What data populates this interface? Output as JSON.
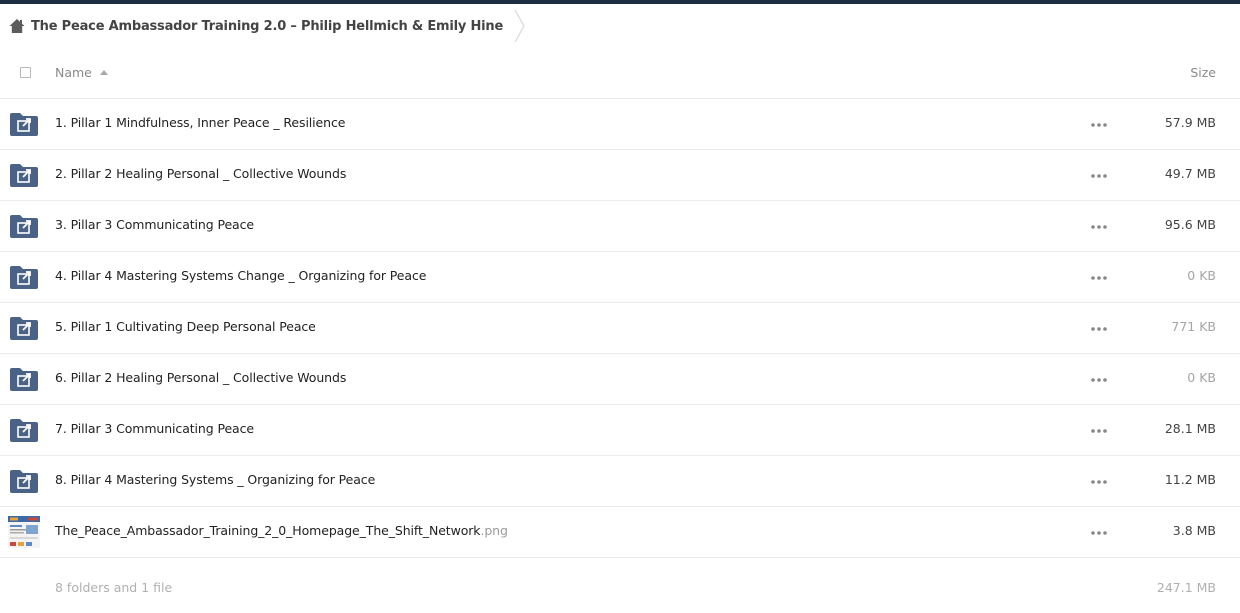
{
  "breadcrumb": {
    "home_icon": "home-icon",
    "folder_name": "The Peace Ambassador Training 2.0 – Philip Hellmich & Emily Hine"
  },
  "header": {
    "name_label": "Name",
    "size_label": "Size",
    "sort_icon": "sort-ascending-icon"
  },
  "colors": {
    "folder": "#4a6286",
    "topbar": "#1d2d44",
    "size_dark": "#444444",
    "size_light": "#a5a5a5"
  },
  "rows": [
    {
      "name": "1. Pillar 1 Mindfulness, Inner Peace _ Resilience",
      "ext": "",
      "size": "57.9 MB",
      "icon": "shared-folder-icon"
    },
    {
      "name": "2. Pillar 2 Healing Personal _ Collective Wounds",
      "ext": "",
      "size": "49.7 MB",
      "icon": "shared-folder-icon"
    },
    {
      "name": "3. Pillar 3 Communicating Peace",
      "ext": "",
      "size": "95.6 MB",
      "icon": "shared-folder-icon"
    },
    {
      "name": "4. Pillar 4 Mastering Systems Change _ Organizing for Peace",
      "ext": "",
      "size": "0 KB",
      "icon": "shared-folder-icon"
    },
    {
      "name": "5. Pillar 1 Cultivating Deep Personal Peace",
      "ext": "",
      "size": "771 KB",
      "icon": "shared-folder-icon"
    },
    {
      "name": "6. Pillar 2 Healing Personal _ Collective Wounds",
      "ext": "",
      "size": "0 KB",
      "icon": "shared-folder-icon"
    },
    {
      "name": "7. Pillar 3 Communicating Peace",
      "ext": "",
      "size": "28.1 MB",
      "icon": "shared-folder-icon"
    },
    {
      "name": "8. Pillar 4 Mastering Systems _ Organizing for Peace",
      "ext": "",
      "size": "11.2 MB",
      "icon": "shared-folder-icon"
    },
    {
      "name": "The_Peace_Ambassador_Training_2_0_Homepage_The_Shift_Network",
      "ext": ".png",
      "size": "3.8 MB",
      "icon": "image-thumbnail"
    }
  ],
  "footer": {
    "summary": "8 folders and 1 file",
    "total_size": "247.1 MB"
  }
}
